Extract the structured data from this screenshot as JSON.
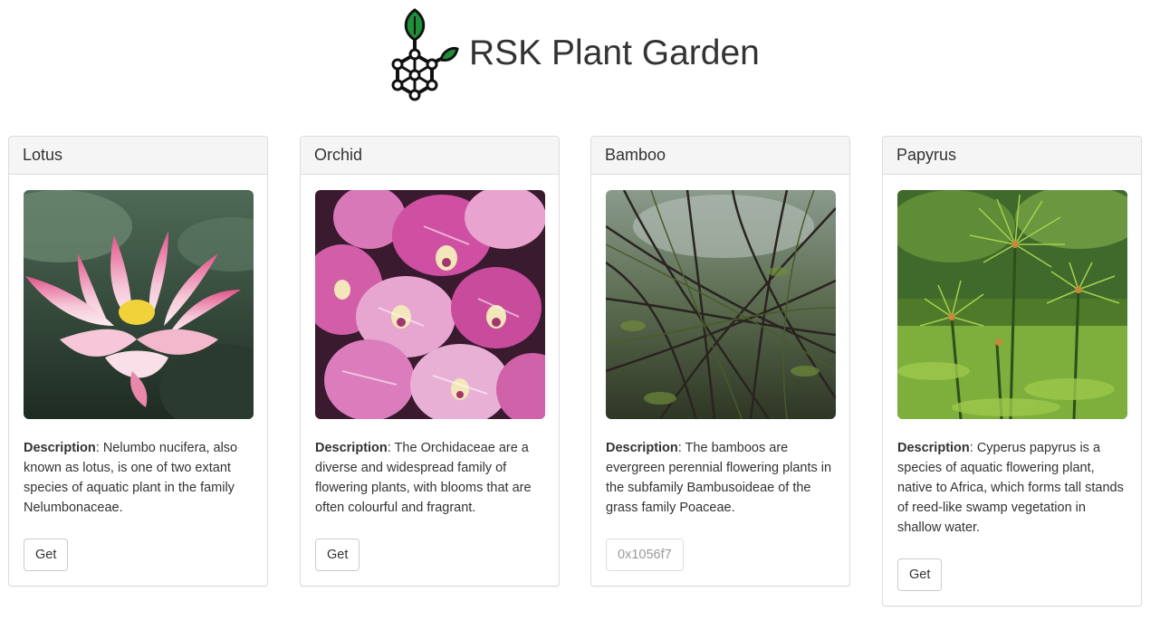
{
  "header": {
    "title": "RSK Plant Garden",
    "logo_icon": "plant-network-logo-icon"
  },
  "colors": {
    "leaf_green": "#1f8f3a",
    "panel_heading_bg": "#f5f5f5",
    "border": "#dddddd",
    "text": "#333333"
  },
  "plants": [
    {
      "name": "Lotus",
      "image": "lotus-photo",
      "description_label": "Description",
      "description_text": ": Nelumbo nucifera, also known as lotus, is one of two extant species of aquatic plant in the family Nelumbonaceae.",
      "button_label": "Get",
      "button_disabled": false
    },
    {
      "name": "Orchid",
      "image": "orchid-photo",
      "description_label": "Description",
      "description_text": ": The Orchidaceae are a diverse and widespread family of flowering plants, with blooms that are often colourful and fragrant.",
      "button_label": "Get",
      "button_disabled": false
    },
    {
      "name": "Bamboo",
      "image": "bamboo-photo",
      "description_label": "Description",
      "description_text": ": The bamboos are evergreen perennial flowering plants in the subfamily Bambusoideae of the grass family Poaceae.",
      "button_label": "0x1056f7",
      "button_disabled": true
    },
    {
      "name": "Papyrus",
      "image": "papyrus-photo",
      "description_label": "Description",
      "description_text": ": Cyperus papyrus is a species of aquatic flowering plant, native to Africa, which forms tall stands of reed-like swamp vegetation in shallow water.",
      "button_label": "Get",
      "button_disabled": false
    }
  ]
}
